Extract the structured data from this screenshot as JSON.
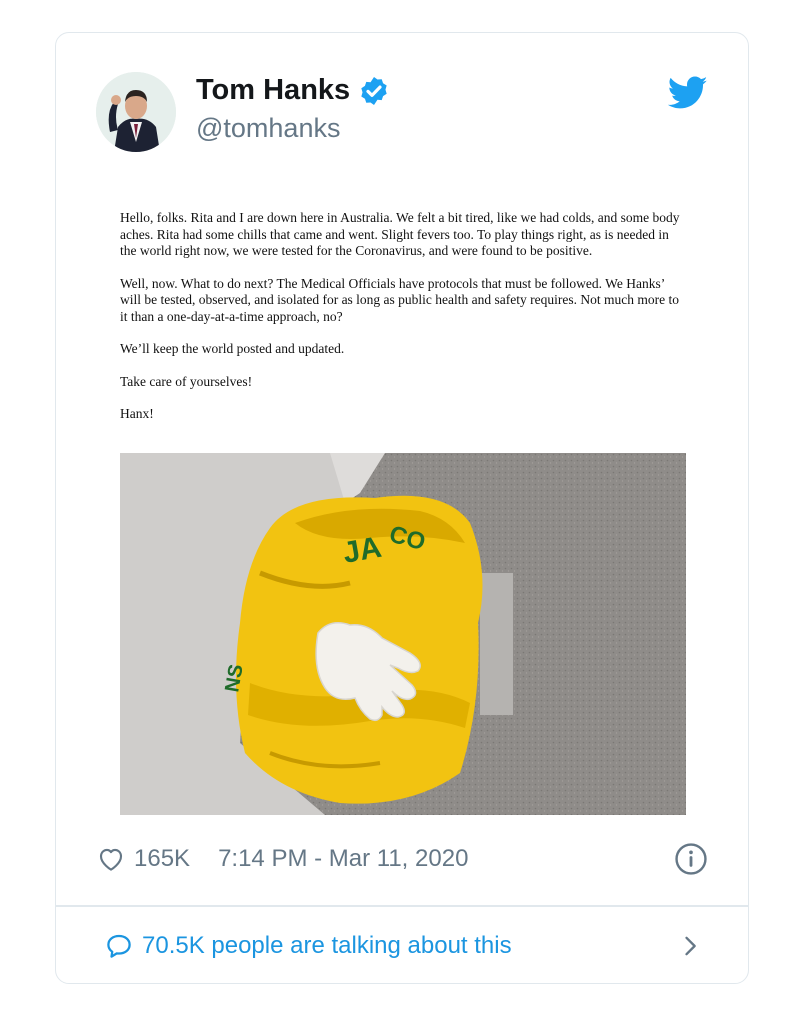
{
  "tweet": {
    "author_name": "Tom Hanks",
    "handle": "@tomhanks",
    "letter_paragraphs": [
      "Hello, folks. Rita and I are down here in Australia. We felt a bit tired, like we had colds, and some body aches. Rita had some chills that came and went. Slight fevers too. To play things right, as is needed in the world right now, we were tested for the Coronavirus, and were found to be positive.",
      "Well, now. What to do next? The Medical Officials have protocols that must be followed. We Hanks’ will be tested, observed, and isolated for as long as public health and safety requires.  Not much more to it than a one-day-at-a-time approach, no?",
      "We’ll keep the world posted and updated.",
      "Take care of yourselves!",
      "Hanx!"
    ],
    "likes": "165K",
    "timestamp": "7:14 PM - Mar 11, 2020",
    "talking": "70.5K people are talking about this"
  },
  "icons": {
    "verified": "verified-badge-icon",
    "brand": "twitter-bird-icon",
    "like": "heart-icon",
    "info": "info-icon",
    "reply": "comment-bubble-icon",
    "chevron": "chevron-right-icon"
  },
  "colors": {
    "twitter_blue": "#1da1f2",
    "link_blue": "#1b95e0",
    "secondary_text": "#657786",
    "border": "#e1e8ed"
  }
}
